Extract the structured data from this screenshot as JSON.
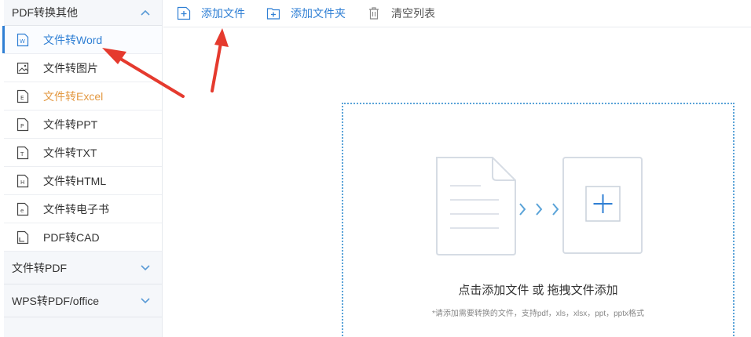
{
  "sidebar": {
    "group1": {
      "label": "PDF转换其他"
    },
    "items": [
      {
        "label": "文件转Word"
      },
      {
        "label": "文件转图片"
      },
      {
        "label": "文件转Excel"
      },
      {
        "label": "文件转PPT"
      },
      {
        "label": "文件转TXT"
      },
      {
        "label": "文件转HTML"
      },
      {
        "label": "文件转电子书"
      },
      {
        "label": "PDF转CAD"
      }
    ],
    "group2": {
      "label": "文件转PDF"
    },
    "group3": {
      "label": "WPS转PDF/office"
    }
  },
  "toolbar": {
    "add_file": "添加文件",
    "add_folder": "添加文件夹",
    "clear_list": "清空列表"
  },
  "dropzone": {
    "title": "点击添加文件 或 拖拽文件添加",
    "hint": "*请添加需要转换的文件，支持pdf，xls，xlsx，ppt，pptx格式"
  },
  "colors": {
    "accent": "#2f7fd4",
    "orange": "#e39840",
    "annotation_arrow": "#e53a2e"
  }
}
